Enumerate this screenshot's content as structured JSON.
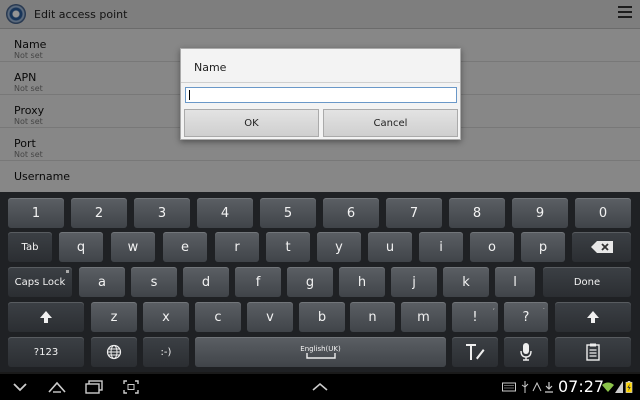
{
  "actionbar": {
    "title": "Edit access point"
  },
  "preferences": [
    {
      "title": "Name",
      "summary": "Not set"
    },
    {
      "title": "APN",
      "summary": "Not set"
    },
    {
      "title": "Proxy",
      "summary": "Not set"
    },
    {
      "title": "Port",
      "summary": "Not set"
    },
    {
      "title": "Username",
      "summary": ""
    }
  ],
  "dialog": {
    "title": "Name",
    "input_value": "",
    "ok_label": "OK",
    "cancel_label": "Cancel"
  },
  "keyboard": {
    "row1": [
      "1",
      "2",
      "3",
      "4",
      "5",
      "6",
      "7",
      "8",
      "9",
      "0"
    ],
    "row2": [
      "q",
      "w",
      "e",
      "r",
      "t",
      "y",
      "u",
      "i",
      "o",
      "p"
    ],
    "row3": [
      "a",
      "s",
      "d",
      "f",
      "g",
      "h",
      "j",
      "k",
      "l"
    ],
    "row4": [
      "z",
      "x",
      "c",
      "v",
      "b",
      "n",
      "m",
      "!",
      "?"
    ],
    "tab_label": "Tab",
    "caps_label": "Caps Lock",
    "done_label": "Done",
    "symbols_label": "?123",
    "emoticon_label": ":-)",
    "space_label": "English(UK)",
    "row4_sup": [
      ",",
      "."
    ]
  },
  "status": {
    "time": "07:27"
  }
}
